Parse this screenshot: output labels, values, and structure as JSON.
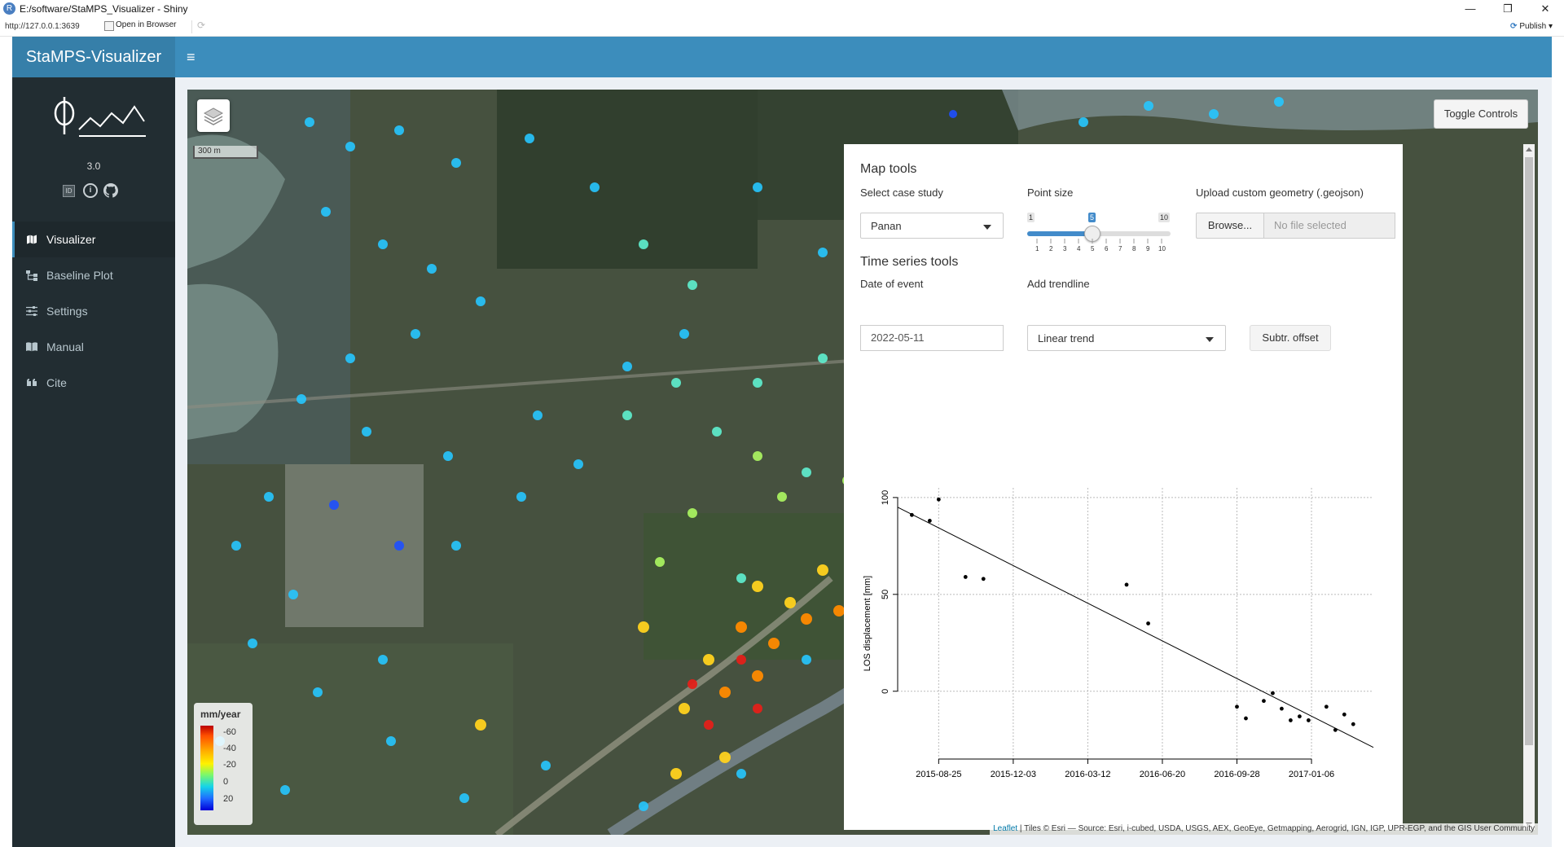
{
  "window": {
    "title": "E:/software/StaMPS_Visualizer - Shiny",
    "url": "http://127.0.0.1:3639",
    "open_in_browser": "Open in Browser",
    "publish": "Publish",
    "minimize": "—",
    "restore": "❐",
    "close": "✕"
  },
  "app": {
    "title": "StaMPS-Visualizer",
    "version": "3.0"
  },
  "sidebar": {
    "items": [
      {
        "label": "Visualizer",
        "icon": "map-icon",
        "active": true
      },
      {
        "label": "Baseline Plot",
        "icon": "sitemap-icon",
        "active": false
      },
      {
        "label": "Settings",
        "icon": "sliders-icon",
        "active": false
      },
      {
        "label": "Manual",
        "icon": "book-icon",
        "active": false
      },
      {
        "label": "Cite",
        "icon": "quote-icon",
        "active": false
      }
    ]
  },
  "map": {
    "scale_label": "300 m",
    "toggle_controls": "Toggle Controls",
    "legend": {
      "title": "mm/year",
      "ticks": [
        "-60",
        "-40",
        "-20",
        "0",
        "20"
      ]
    },
    "attribution_link": "Leaflet",
    "attribution_text": " | Tiles © Esri — Source: Esri, i-cubed, USDA, USGS, AEX, GeoEye, Getmapping, Aerogrid, IGN, IGP, UPR-EGP, and the GIS User Community"
  },
  "controls": {
    "map_tools": {
      "title": "Map tools",
      "case_study_label": "Select case study",
      "case_study_value": "Panan",
      "point_size_label": "Point size",
      "point_size_min": "1",
      "point_size_max": "10",
      "point_size_value": "5",
      "point_size_ticks": [
        "1",
        "2",
        "3",
        "4",
        "5",
        "6",
        "7",
        "8",
        "9",
        "10"
      ],
      "upload_label": "Upload custom geometry (.geojson)",
      "browse_label": "Browse...",
      "file_placeholder": "No file selected"
    },
    "time_series_tools": {
      "title": "Time series tools",
      "date_label": "Date of event",
      "date_value": "2022-05-11",
      "trendline_label": "Add trendline",
      "trendline_value": "Linear trend",
      "subtract_offset": "Subtr. offset"
    }
  },
  "chart_data": {
    "type": "scatter",
    "title": "",
    "xlabel": "",
    "ylabel": "LOS displacement [mm]",
    "x_tick_labels": [
      "2015-08-25",
      "2015-12-03",
      "2016-03-12",
      "2016-06-20",
      "2016-09-28",
      "2017-01-06"
    ],
    "x_ticks": [
      "2015-08-25",
      "2015-12-03",
      "2016-03-12",
      "2016-06-20",
      "2016-09-28",
      "2017-01-06"
    ],
    "y_ticks": [
      0,
      50,
      100
    ],
    "xlim": [
      "2015-07-01",
      "2017-03-30"
    ],
    "ylim": [
      -35,
      105
    ],
    "grid": true,
    "points": [
      {
        "x": "2015-07-20",
        "y": 91
      },
      {
        "x": "2015-08-13",
        "y": 88
      },
      {
        "x": "2015-08-25",
        "y": 99
      },
      {
        "x": "2015-09-30",
        "y": 59
      },
      {
        "x": "2015-10-24",
        "y": 58
      },
      {
        "x": "2016-05-03",
        "y": 55
      },
      {
        "x": "2016-06-01",
        "y": 35
      },
      {
        "x": "2016-09-28",
        "y": -8
      },
      {
        "x": "2016-10-10",
        "y": -14
      },
      {
        "x": "2016-11-03",
        "y": -5
      },
      {
        "x": "2016-11-15",
        "y": -1
      },
      {
        "x": "2016-11-27",
        "y": -9
      },
      {
        "x": "2016-12-09",
        "y": -15
      },
      {
        "x": "2016-12-21",
        "y": -13
      },
      {
        "x": "2017-01-02",
        "y": -15
      },
      {
        "x": "2017-01-26",
        "y": -8
      },
      {
        "x": "2017-02-07",
        "y": -20
      },
      {
        "x": "2017-02-19",
        "y": -12
      },
      {
        "x": "2017-03-03",
        "y": -17
      }
    ],
    "trendline": {
      "type": "linear",
      "x": [
        "2015-07-01",
        "2017-03-30"
      ],
      "y": [
        95,
        -29
      ]
    }
  }
}
